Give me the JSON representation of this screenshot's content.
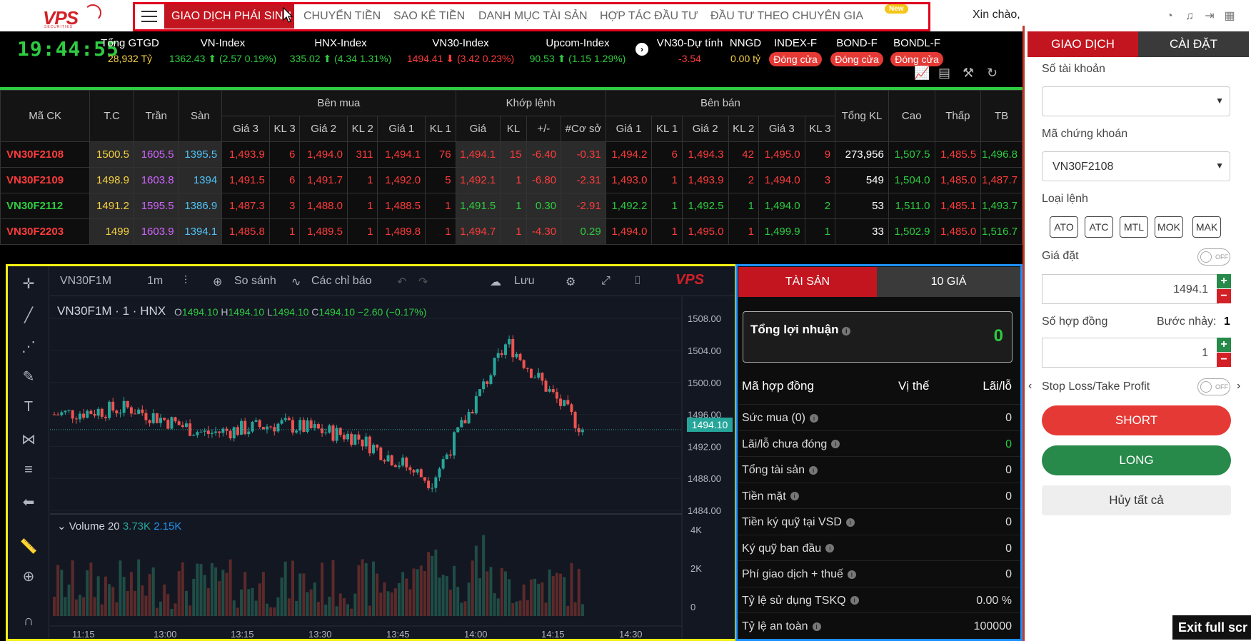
{
  "app": {
    "logo_text": "VPS",
    "logo_sub": "SECURITIES"
  },
  "nav": {
    "items": [
      "GIAO DỊCH PHÁI SINH",
      "CHUYỂN TIỀN",
      "SAO KÊ TIỀN",
      "DANH MỤC TÀI SẢN",
      "HỢP TÁC ĐẦU TƯ",
      "ĐẦU TƯ THEO CHUYÊN GIA"
    ],
    "new_badge": "New",
    "greeting": "Xin chào,"
  },
  "market": {
    "clock": "19:44:55",
    "gtgd_label": "Tổng GTGD",
    "gtgd_value": "28,932 Tỷ",
    "vnindex_label": "VN-Index",
    "vnindex_value": "1362.43 ⬆ (2.57 0.19%)",
    "hnx_label": "HNX-Index",
    "hnx_value": "335.02 ⬆ (4.34 1.31%)",
    "vn30_label": "VN30-Index",
    "vn30_value": "1494.41 ⬇ (3.42 0.23%)",
    "upcom_label": "Upcom-Index",
    "upcom_value": "90.53 ⬆ (1.15 1.29%)",
    "vn30est_label": "VN30-Dự tính",
    "vn30est_value": "-3.54",
    "nngd_label": "NNGD",
    "nngd_value": "0.00 tỷ",
    "indexf_label": "INDEX-F",
    "bondf_label": "BOND-F",
    "bondl_label": "BONDL-F",
    "closed_label": "Đóng cửa"
  },
  "board": {
    "h_code": "Mã CK",
    "h_ref": "T.C",
    "h_ceil": "Trần",
    "h_floor": "Sàn",
    "h_buy": "Bên mua",
    "h_match": "Khớp lệnh",
    "h_sell": "Bên bán",
    "h_total": "Tổng KL",
    "h_high": "Cao",
    "h_low": "Thấp",
    "h_avg": "TB",
    "sub": [
      "Giá 3",
      "KL 3",
      "Giá 2",
      "KL 2",
      "Giá 1",
      "KL 1",
      "Giá",
      "KL",
      "+/-",
      "#Cơ sở",
      "Giá 1",
      "KL 1",
      "Giá 2",
      "KL 2",
      "Giá 3",
      "KL 3"
    ],
    "rows": [
      {
        "code": "VN30F2108",
        "cells": [
          "1500.5",
          "1605.5",
          "1395.5",
          "1,493.9",
          "6",
          "1,494.0",
          "311",
          "1,494.1",
          "76",
          "1,494.1",
          "15",
          "-6.40",
          "-0.31",
          "1,494.2",
          "6",
          "1,494.3",
          "42",
          "1,495.0",
          "9",
          "273,956",
          "1,507.5",
          "1,485.5",
          "1,496.8"
        ]
      },
      {
        "code": "VN30F2109",
        "cells": [
          "1498.9",
          "1603.8",
          "1394",
          "1,491.5",
          "6",
          "1,491.7",
          "1",
          "1,492.0",
          "5",
          "1,492.1",
          "1",
          "-6.80",
          "-2.31",
          "1,493.0",
          "1",
          "1,493.9",
          "2",
          "1,494.0",
          "3",
          "549",
          "1,504.0",
          "1,485.0",
          "1,487.7"
        ]
      },
      {
        "code": "VN30F2112",
        "cells": [
          "1491.2",
          "1595.5",
          "1386.9",
          "1,487.3",
          "3",
          "1,488.0",
          "1",
          "1,488.5",
          "1",
          "1,491.5",
          "1",
          "0.30",
          "-2.91",
          "1,492.2",
          "1",
          "1,492.5",
          "1",
          "1,494.0",
          "2",
          "53",
          "1,511.0",
          "1,485.1",
          "1,493.7"
        ]
      },
      {
        "code": "VN30F2203",
        "cells": [
          "1499",
          "1603.9",
          "1394.1",
          "1,485.8",
          "1",
          "1,489.5",
          "1",
          "1,489.8",
          "1",
          "1,494.7",
          "1",
          "-4.30",
          "0.29",
          "1,494.0",
          "1",
          "1,495.0",
          "1",
          "1,499.9",
          "1",
          "33",
          "1,502.9",
          "1,485.0",
          "1,516.7"
        ]
      }
    ]
  },
  "chart": {
    "symbol": "VN30F1M",
    "interval": "1m",
    "compare": "So sánh",
    "indicators": "Các chỉ báo",
    "save": "Lưu",
    "legend": "VN30F1M · 1 · HNX",
    "o": "1494.10",
    "h": "1494.10",
    "l": "1494.10",
    "c": "1494.10",
    "chg": "−2.60 (−0.17%)",
    "volume_label": "Volume",
    "volume_len": "20",
    "vol1": "3.73K",
    "vol2": "2.15K",
    "price_label": "1494.10",
    "y_ticks": [
      "1508.00",
      "1504.00",
      "1500.00",
      "1496.00",
      "1492.00",
      "1488.00",
      "1484.00"
    ],
    "vol_ticks": [
      "4K",
      "2K",
      "0"
    ],
    "x_ticks": [
      "11:15",
      "13:00",
      "13:15",
      "13:30",
      "13:45",
      "14:00",
      "14:15",
      "14:30"
    ]
  },
  "chart_data": {
    "type": "candlestick",
    "title": "VN30F1M · 1 · HNX",
    "x": [
      "11:15",
      "13:00",
      "13:15",
      "13:30",
      "13:45",
      "14:00",
      "14:15",
      "14:30"
    ],
    "close": [
      1496.0,
      1496.8,
      1493.6,
      1494.8,
      1493.2,
      1487.6,
      1505.0,
      1494.1
    ],
    "ylim": [
      1484,
      1509
    ]
  },
  "assets": {
    "tab_assets": "TÀI SẢN",
    "tab_prices": "10 GIÁ",
    "profit_label": "Tổng lợi nhuận",
    "profit_value": "0",
    "col_contract": "Mã hợp đồng",
    "col_position": "Vị thế",
    "col_pnl": "Lãi/lỗ",
    "rows": [
      {
        "label": "Sức mua (0)",
        "value": "0"
      },
      {
        "label": "Lãi/lỗ chưa đóng",
        "value": "0"
      },
      {
        "label": "Tổng tài sản",
        "value": "0"
      },
      {
        "label": "Tiền mặt",
        "value": "0"
      },
      {
        "label": "Tiền ký quỹ tại VSD",
        "value": "0"
      },
      {
        "label": "Ký quỹ ban đầu",
        "value": "0"
      },
      {
        "label": "Phí giao dịch + thuế",
        "value": "0"
      },
      {
        "label": "Tỷ lệ sử dụng TSKQ",
        "value": "0.00 %"
      },
      {
        "label": "Tỷ lệ an toàn",
        "value": "100000"
      }
    ]
  },
  "order": {
    "tab_trade": "GIAO DỊCH",
    "tab_settings": "CÀI ĐẶT",
    "account_label": "Số tài khoản",
    "account_value": "",
    "symbol_label": "Mã chứng khoán",
    "symbol_value": "VN30F2108",
    "type_label": "Loại lệnh",
    "types": [
      "ATO",
      "ATC",
      "MTL",
      "MOK",
      "MAK"
    ],
    "price_label": "Giá đặt",
    "price_value": "1494.1",
    "qty_label": "Số hợp đồng",
    "step_label": "Bước nhảy:",
    "step_value": "1",
    "qty_value": "1",
    "sltp_label": "Stop Loss/Take Profit",
    "toggle_off": "OFF",
    "short_label": "SHORT",
    "long_label": "LONG",
    "cancel_all_label": "Hủy tất cả"
  },
  "overlay": {
    "exit_fullscreen": "Exit full scr"
  },
  "colors": {
    "brand_red": "#c3151f",
    "up": "#2ecc40",
    "down": "#ff3b3b",
    "long_green": "#27894a"
  }
}
